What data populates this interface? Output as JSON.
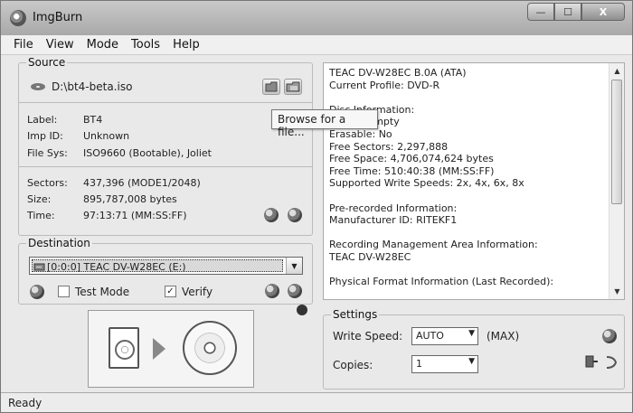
{
  "window": {
    "title": "ImgBurn",
    "controls": {
      "minimize": "—",
      "maximize": "☐",
      "close": "X"
    }
  },
  "menu": [
    "File",
    "View",
    "Mode",
    "Tools",
    "Help"
  ],
  "source": {
    "legend": "Source",
    "file": "D:\\bt4-beta.iso",
    "tooltip": "Browse for a file...",
    "label_key": "Label:",
    "label_val": "BT4",
    "impid_key": "Imp ID:",
    "impid_val": "Unknown",
    "filesys_key": "File Sys:",
    "filesys_val": "ISO9660 (Bootable), Joliet",
    "sectors_key": "Sectors:",
    "sectors_val": "437,396 (MODE1/2048)",
    "size_key": "Size:",
    "size_val": "895,787,008 bytes",
    "time_key": "Time:",
    "time_val": "97:13:71 (MM:SS:FF)"
  },
  "destination": {
    "legend": "Destination",
    "drive": "[0:0:0] TEAC DV-W28EC (E:)",
    "test_mode": "Test Mode",
    "test_mode_checked": false,
    "verify": "Verify",
    "verify_checked": true
  },
  "info_lines": "TEAC DV-W28EC B.0A (ATA)\nCurrent Profile: DVD-R\n\nDisc Information:\nStatus: Empty\nErasable: No\nFree Sectors: 2,297,888\nFree Space: 4,706,074,624 bytes\nFree Time: 510:40:38 (MM:SS:FF)\nSupported Write Speeds: 2x, 4x, 6x, 8x\n\nPre-recorded Information:\nManufacturer ID: RITEKF1\n\nRecording Management Area Information:\nTEAC DV-W28EC\n\nPhysical Format Information (Last Recorded):",
  "settings": {
    "legend": "Settings",
    "write_speed_label": "Write Speed:",
    "write_speed": "AUTO",
    "max_label": "(MAX)",
    "copies_label": "Copies:",
    "copies": "1"
  },
  "status": "Ready"
}
